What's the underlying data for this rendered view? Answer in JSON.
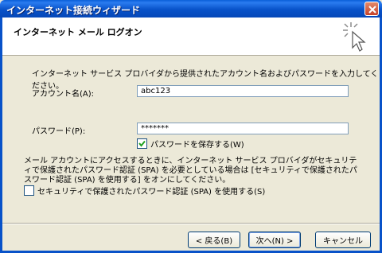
{
  "window": {
    "title": "インターネット接続ウィザード"
  },
  "header": {
    "title": "インターネット メール ログオン"
  },
  "intro": "インターネット サービス プロバイダから提供されたアカウント名およびパスワードを入力してください。",
  "account": {
    "label": "アカウント名(A):",
    "value": "abc123"
  },
  "password": {
    "label": "パスワード(P):",
    "value": "*******"
  },
  "remember": {
    "label": "パスワードを保存する(W)",
    "checked": true
  },
  "spa_description": "メール アカウントにアクセスするときに、インターネット サービス プロバイダがセキュリティで保護されたパスワード認証 (SPA) を必要としている場合は [セキュリティで保護されたパスワード認証 (SPA) を使用する] をオンにしてください。",
  "spa": {
    "label": "セキュリティで保護されたパスワード認証 (SPA) を使用する(S)",
    "checked": false
  },
  "buttons": {
    "back": "< 戻る(B)",
    "next": "次へ(N) >",
    "cancel": "キャンセル"
  }
}
